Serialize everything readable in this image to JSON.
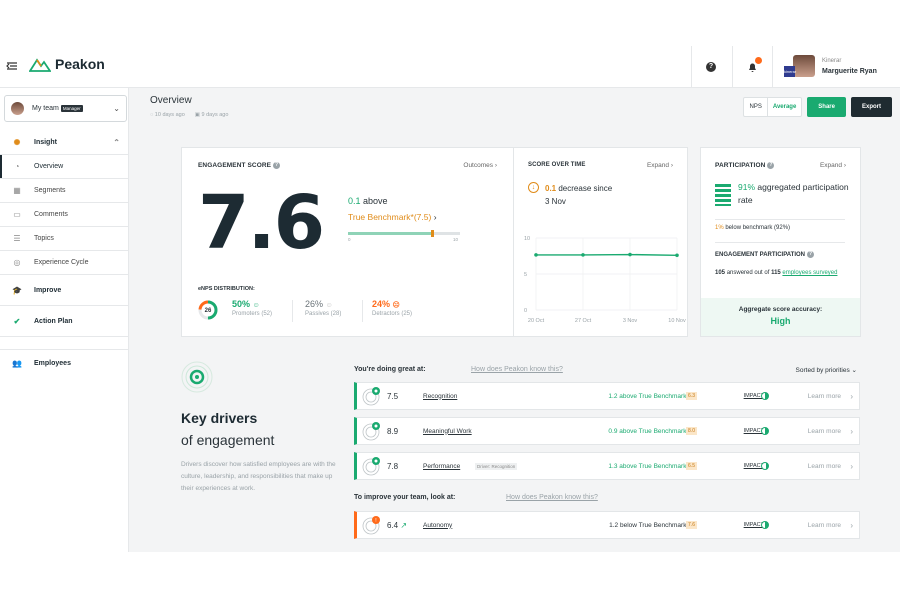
{
  "brand": {
    "name": "Peakon",
    "accent": "#1aaa70",
    "warn": "#e08c1a",
    "dark": "#1d2b33"
  },
  "user": {
    "company": "Kinerar",
    "name": "Marguerite Ryan"
  },
  "sidebar": {
    "team": "My team",
    "team_tag": "Manager",
    "items": [
      {
        "label": "Insight",
        "icon": "insight-icon"
      },
      {
        "label": "Overview",
        "icon": "overview-icon"
      },
      {
        "label": "Segments",
        "icon": "segments-icon"
      },
      {
        "label": "Comments",
        "icon": "comments-icon"
      },
      {
        "label": "Topics",
        "icon": "topics-icon"
      },
      {
        "label": "Experience Cycle",
        "icon": "cycle-icon"
      },
      {
        "label": "Improve",
        "icon": "improve-icon"
      },
      {
        "label": "Action Plan",
        "icon": "action-plan-icon"
      },
      {
        "label": "Employees",
        "icon": "employees-icon"
      }
    ]
  },
  "page": {
    "title": "Overview",
    "meta1": "10 days ago",
    "meta2": "9 days ago"
  },
  "toolbar": {
    "nps": "NPS",
    "average": "Average",
    "share": "Share",
    "export": "Export"
  },
  "engagement": {
    "title": "ENGAGEMENT SCORE",
    "outcomes": "Outcomes",
    "score": "7.6",
    "delta": "0.1",
    "delta_suffix": "above",
    "benchmark": "True Benchmark*(7.5)",
    "bar_min": "0",
    "bar_max": "10",
    "fill_pct": 76,
    "marker_pct": 75,
    "enps_title": "eNPS DISTRIBUTION:",
    "enps_score": "26",
    "promoters_pct": "50%",
    "promoters_lbl": "Promoters (52)",
    "passives_pct": "26%",
    "passives_lbl": "Passives (28)",
    "detractors_pct": "24%",
    "detractors_lbl": "Detractors (25)"
  },
  "trend": {
    "title": "SCORE OVER TIME",
    "expand": "Expand",
    "delta": "0.1",
    "text": "decrease since",
    "since": "3 Nov"
  },
  "chart_data": {
    "type": "line",
    "x": [
      "20 Oct",
      "27 Oct",
      "3 Nov",
      "10 Nov"
    ],
    "series": [
      {
        "values": [
          7.65,
          7.65,
          7.7,
          7.6
        ]
      }
    ],
    "ylim": [
      0,
      10
    ],
    "yticks": [
      "10",
      "5",
      "0"
    ],
    "color": "#1aaa70"
  },
  "participation": {
    "title": "PARTICIPATION",
    "expand": "Expand",
    "pct": "91%",
    "text": "aggregated participation rate",
    "below_pct": "1%",
    "below_text": "below benchmark (92%)",
    "ep_title": "ENGAGEMENT PARTICIPATION",
    "ep_a": "105",
    "ep_b": "answered out of",
    "ep_c": "115",
    "ep_link": "employees surveyed",
    "acc_label": "Aggregate score accuracy:",
    "acc_val": "High"
  },
  "drivers": {
    "title": "Key drivers",
    "subtitle": "of engagement",
    "desc": "Drivers discover how satisfied employees are with the culture, leadership, and responsibilities that make up their experiences at work.",
    "great_head": "You're doing great at:",
    "great_link": "How does Peakon know this?",
    "improve_head": "To improve your team, look at:",
    "improve_link": "How does Peakon know this?",
    "sorted": "Sorted by priorities",
    "impact": "IMPACT",
    "learn": "Learn more",
    "rows": [
      {
        "score": "7.5",
        "name": "Recognition",
        "tag": "",
        "bm": "1.2 above True Benchmark*",
        "chip": "6.3"
      },
      {
        "score": "8.9",
        "name": "Meaningful Work",
        "tag": "",
        "bm": "0.9 above True Benchmark*",
        "chip": "8.0"
      },
      {
        "score": "7.8",
        "name": "Performance",
        "tag": "Driver: Recognition",
        "bm": "1.3 above True Benchmark*",
        "chip": "6.5"
      },
      {
        "score": "6.4",
        "name": "Autonomy",
        "tag": "",
        "bm": "1.2 below True Benchmark*",
        "chip": "7.6"
      }
    ]
  }
}
